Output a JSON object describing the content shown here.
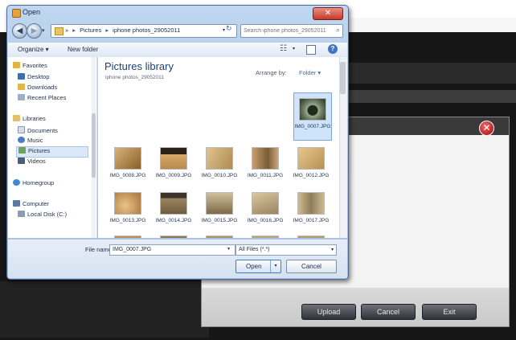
{
  "dialog": {
    "title": "Open",
    "close_symbol": "✕",
    "nav": {
      "back_symbol": "◀",
      "forward_symbol": "▶",
      "history_symbol": "▾",
      "address_crumbs": [
        "»",
        "Pictures",
        "iphone photos_29052011"
      ],
      "address_dropdown": "▾",
      "refresh_symbol": "↻",
      "search_placeholder": "Search iphone photos_29052011"
    },
    "commandbar": {
      "organize_label": "Organize ▾",
      "new_folder_label": "New folder",
      "views_symbol": "☷",
      "views_dropdown": "▾",
      "help_symbol": "?"
    },
    "sidebar": {
      "items": [
        {
          "label": "Favorites",
          "icon": "star-icon",
          "color": "#e5b53a"
        },
        {
          "label": "Desktop",
          "icon": "desktop-icon",
          "color": "#3e6db0"
        },
        {
          "label": "Downloads",
          "icon": "downloads-icon",
          "color": "#e2b54a"
        },
        {
          "label": "Recent Places",
          "icon": "recent-places-icon",
          "color": "#9bb0c8"
        },
        {
          "label": "Libraries",
          "icon": "libraries-icon",
          "color": "#e2c06a"
        },
        {
          "label": "Documents",
          "icon": "documents-icon",
          "color": "#d8dde6"
        },
        {
          "label": "Music",
          "icon": "music-icon",
          "color": "#4a7cc4"
        },
        {
          "label": "Pictures",
          "icon": "pictures-icon",
          "color": "#6fa35a"
        },
        {
          "label": "Videos",
          "icon": "videos-icon",
          "color": "#4f5f73"
        },
        {
          "label": "Homegroup",
          "icon": "homegroup-icon",
          "color": "#3c8ad0"
        },
        {
          "label": "Computer",
          "icon": "computer-icon",
          "color": "#5c78a0"
        },
        {
          "label": "Local Disk (C:)",
          "icon": "local-disk-icon",
          "color": "#8b9bb0"
        }
      ],
      "selected": "Pictures"
    },
    "content": {
      "library_title": "Pictures library",
      "library_subtitle": "iphone photos_29052011",
      "arrange_label": "Arrange by:",
      "arrange_value": "Folder ▾",
      "files": [
        {
          "name": "IMG_0007.JPG",
          "color": "#8a9a84",
          "selected": true
        },
        {
          "name": "IMG_0008.JPG",
          "color": "#b3844a"
        },
        {
          "name": "IMG_0009.JPG",
          "color": "#c49a5a"
        },
        {
          "name": "IMG_0010.JPG",
          "color": "#c4a26a"
        },
        {
          "name": "IMG_0011.JPG",
          "color": "#b89462"
        },
        {
          "name": "IMG_0012.JPG",
          "color": "#c7a468"
        },
        {
          "name": "IMG_0013.JPG",
          "color": "#c48a4e"
        },
        {
          "name": "IMG_0014.JPG",
          "color": "#8a7456"
        },
        {
          "name": "IMG_0015.JPG",
          "color": "#a89064"
        },
        {
          "name": "IMG_0016.JPG",
          "color": "#b9a27e"
        },
        {
          "name": "IMG_0017.JPG",
          "color": "#b0a280"
        }
      ]
    },
    "bottom": {
      "filename_label": "File name:",
      "filename_value": "IMG_0007.JPG",
      "filename_dropdown": "▾",
      "filetype_value": "All Files (*.*)",
      "filetype_dropdown": "▾",
      "open_label": "Open",
      "open_split": "▾",
      "cancel_label": "Cancel"
    }
  },
  "background_app": {
    "close_symbol": "✕",
    "upload_label": "Upload",
    "cancel_label": "Cancel",
    "exit_label": "Exit"
  }
}
